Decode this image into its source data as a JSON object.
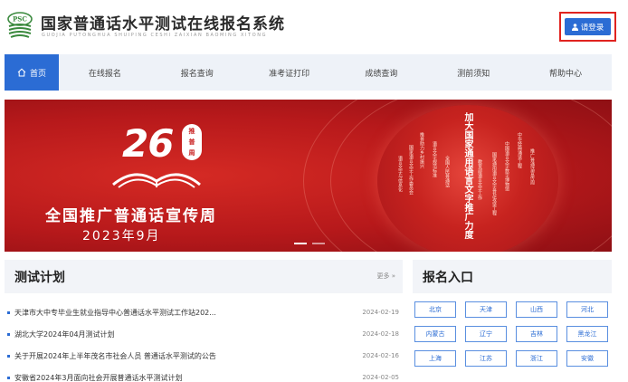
{
  "header": {
    "logo_text": "PSC",
    "title": "国家普通话水平测试在线报名系统",
    "subtitle": "GUOJIA PUTONGHUA SHUIPING CESHI ZAIXIAN BAOMING XITONG",
    "login_label": "请登录",
    "login_icon": "user-icon"
  },
  "nav": {
    "items": [
      {
        "label": "首页",
        "icon": "home-icon"
      },
      {
        "label": "在线报名"
      },
      {
        "label": "报名查询"
      },
      {
        "label": "准考证打印"
      },
      {
        "label": "成绩查询"
      },
      {
        "label": "测前须知"
      },
      {
        "label": "帮助中心"
      }
    ]
  },
  "banner": {
    "number": "26",
    "badge": [
      "推",
      "普",
      "周"
    ],
    "headline": "全国推广普通话宣传周",
    "date": "2023年9月",
    "globe_main": "加大国家通用语言文字推广力度",
    "globe_lines": [
      "中华经典诵读工程",
      "中国语言文字数字博物馆",
      "国家通用语言文字普及攻坚工程",
      "教育部语言文字工作",
      "全国人民普通话",
      "语言文字规范标准",
      "推普助力乡村振兴",
      "国家语言文字工作委员会",
      "语言文字与信息化",
      "推广普通话宣传周"
    ],
    "slides": 2,
    "active_slide": 0
  },
  "plan": {
    "title": "测试计划",
    "more_label": "更多 »",
    "rows": [
      {
        "text": "天津市大中专毕业生就业指导中心普通话水平测试工作站202...",
        "date": "2024-02-19"
      },
      {
        "text": "湖北大学2024年04月测试计划",
        "date": "2024-02-18"
      },
      {
        "text": "关于开展2024年上半年茂名市社会人员 普通话水平测试的公告",
        "date": "2024-02-16"
      },
      {
        "text": "安徽省2024年3月面向社会开展普通话水平测试计划",
        "date": "2024-02-05"
      }
    ]
  },
  "registration": {
    "title": "报名入口",
    "provinces": [
      "北京",
      "天津",
      "山西",
      "河北",
      "内蒙古",
      "辽宁",
      "吉林",
      "黑龙江",
      "上海",
      "江苏",
      "浙江",
      "安徽"
    ]
  },
  "colors": {
    "primary": "#2b6cd4",
    "banner_red": "#c81e1e",
    "login_frame": "#e0231f",
    "panel_head": "#f2f4f8",
    "logo_green": "#3b8a3e"
  }
}
